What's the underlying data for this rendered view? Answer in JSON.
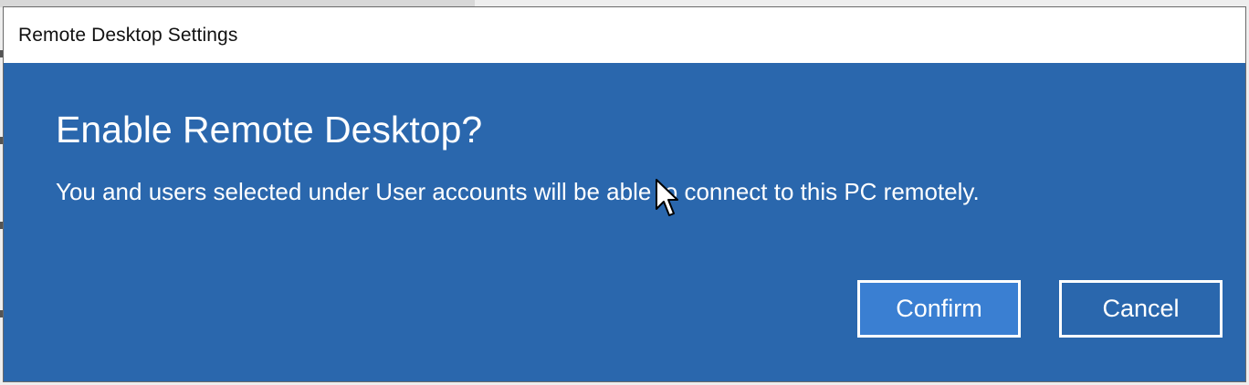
{
  "window": {
    "title": "Remote Desktop Settings"
  },
  "dialog": {
    "heading": "Enable Remote Desktop?",
    "message": "You and users selected under User accounts will be able to connect to this PC remotely.",
    "confirm_label": "Confirm",
    "cancel_label": "Cancel"
  },
  "colors": {
    "dialog_background": "#2a67ad",
    "confirm_background": "#3a7fd2",
    "text": "#ffffff"
  },
  "icons": {
    "cursor": "mouse-pointer-icon"
  }
}
